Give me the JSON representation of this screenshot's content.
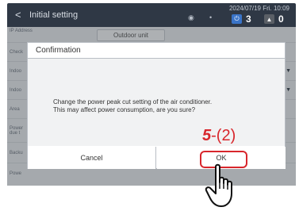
{
  "header": {
    "title": "Initial setting",
    "datetime": "2024/07/19 Fri. 10:09",
    "badge_power_count": "3",
    "badge_alert_count": "0",
    "back_glyph": "<"
  },
  "background": {
    "rows": [
      "IP Address",
      "Check",
      "Indoo",
      "Indoo",
      "Area",
      "Power due t",
      "Backu",
      "Powe"
    ],
    "outdoor_tab": "Outdoor unit"
  },
  "dialog": {
    "title": "Confirmation",
    "message_line1": "Change the power peak cut setting of the air conditioner.",
    "message_line2": "This may affect power consumption, are you sure?",
    "cancel_label": "Cancel",
    "ok_label": "OK"
  },
  "annotation": {
    "step_number": "5",
    "step_sub": "-(2)",
    "color": "#d8262c"
  }
}
